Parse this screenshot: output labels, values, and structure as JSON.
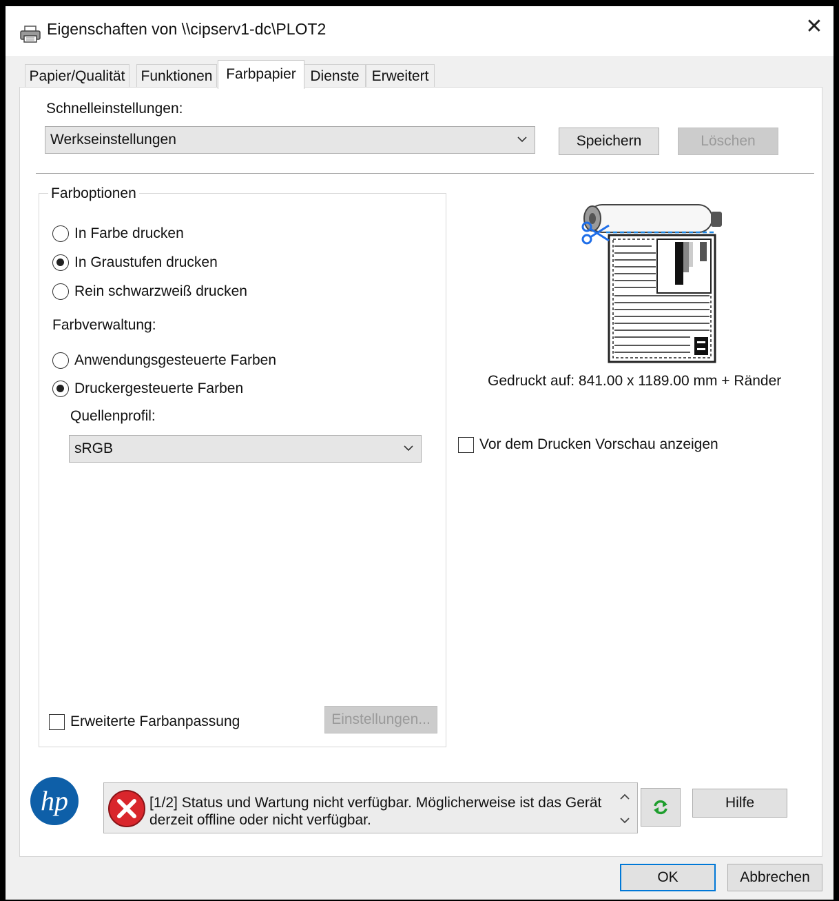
{
  "window": {
    "title": "Eigenschaften von \\\\cipserv1-dc\\PLOT2",
    "icon": "printer-icon",
    "close_label": "✕"
  },
  "tabs": [
    {
      "label": "Papier/Qualität"
    },
    {
      "label": "Funktionen"
    },
    {
      "label": "Farbpapier",
      "active": true
    },
    {
      "label": "Dienste"
    },
    {
      "label": "Erweitert"
    }
  ],
  "quick": {
    "label": "Schnelleinstellungen:",
    "value": "Werkseinstellungen",
    "save_label": "Speichern",
    "delete_label": "Löschen"
  },
  "color_options": {
    "group_label": "Farboptionen",
    "radios": [
      {
        "label": "In Farbe drucken",
        "selected": false
      },
      {
        "label": "In Graustufen drucken",
        "selected": true
      },
      {
        "label": "Rein schwarzweiß drucken",
        "selected": false
      }
    ],
    "management_label": "Farbverwaltung:",
    "management_radios": [
      {
        "label": "Anwendungsgesteuerte Farben",
        "selected": false
      },
      {
        "label": "Druckergesteuerte Farben",
        "selected": true
      }
    ],
    "source_profile_label": "Quellenprofil:",
    "source_profile_value": "sRGB",
    "advanced_checkbox_label": "Erweiterte Farbanpassung",
    "advanced_checked": false,
    "settings_button_label": "Einstellungen..."
  },
  "preview": {
    "printed_on": "Gedruckt auf: 841.00 x 1189.00 mm + Ränder",
    "preview_checkbox_label": "Vor dem Drucken Vorschau anzeigen",
    "preview_checked": false
  },
  "status": {
    "message": "[1/2] Status und Wartung nicht verfügbar. Möglicherweise ist das Gerät derzeit offline oder nicht verfügbar.",
    "help_label": "Hilfe"
  },
  "footer": {
    "ok_label": "OK",
    "cancel_label": "Abbrechen"
  },
  "colors": {
    "accent": "#0078d7",
    "error": "#d9262c",
    "hp_blue": "#0e5fa8",
    "refresh_green": "#1f9e2e"
  }
}
